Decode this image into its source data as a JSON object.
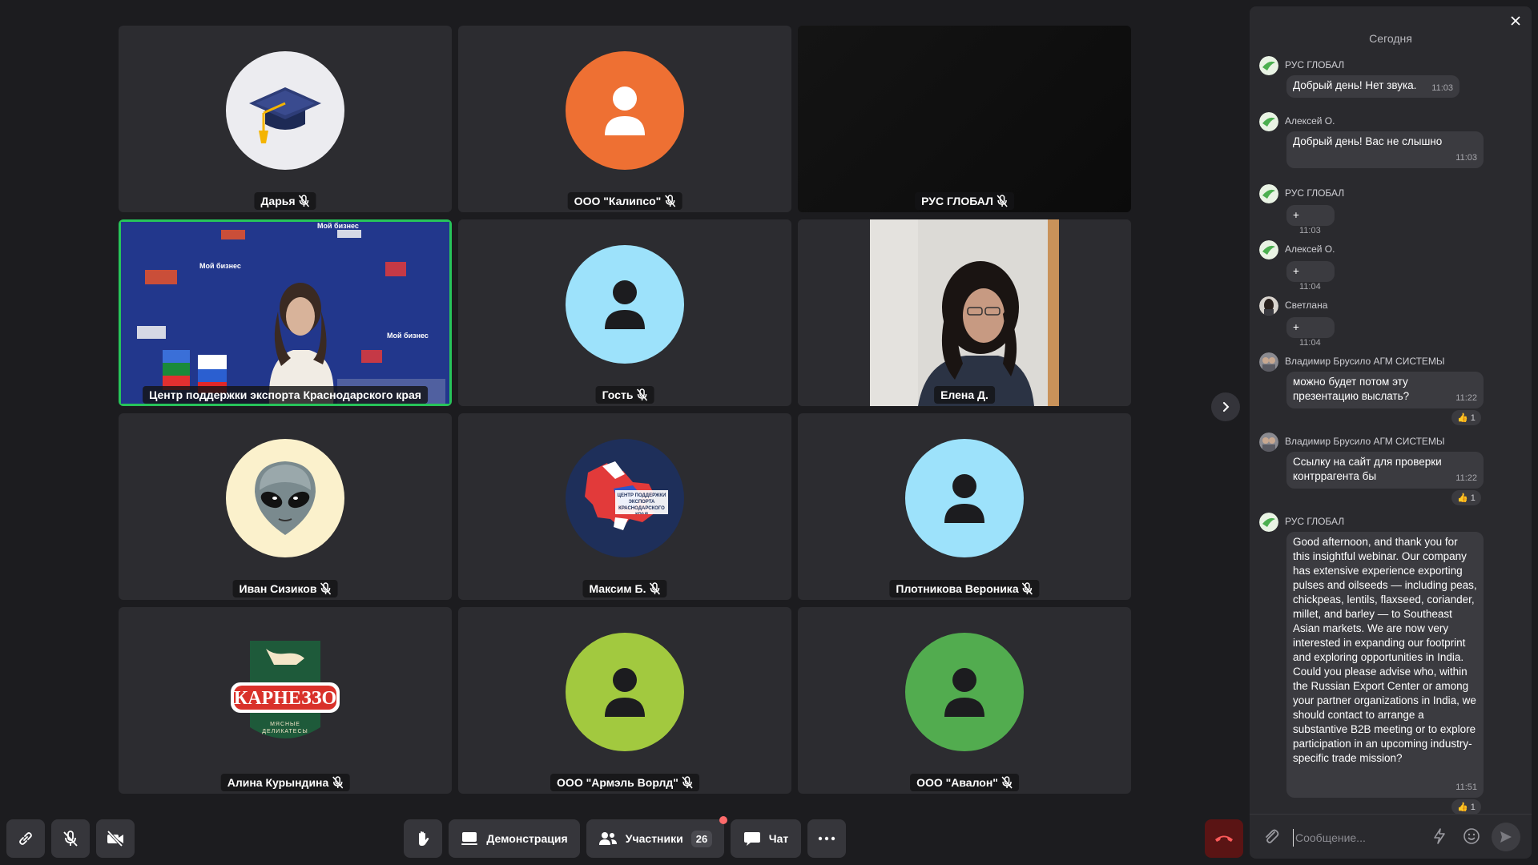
{
  "participants": [
    {
      "name": "Дарья",
      "avatar": "graduation-cap-avatar"
    },
    {
      "name": "ООО \"Калипсо\"",
      "avatar": "person-avatar",
      "color": "#ee7033"
    },
    {
      "name": "РУС ГЛОБАЛ",
      "avatar": "video-dark"
    },
    {
      "name": "Центр поддержки экспорта Краснодарского края",
      "avatar": "video-presenter",
      "speaking": true
    },
    {
      "name": "Гость",
      "avatar": "person-avatar",
      "color": "#9de2fb"
    },
    {
      "name": "Елена Д.",
      "avatar": "video-woman"
    },
    {
      "name": "Иван Сизиков",
      "avatar": "alien-avatar"
    },
    {
      "name": "Максим Б.",
      "avatar": "export-center-logo-avatar"
    },
    {
      "name": "Плотникова Вероника",
      "avatar": "person-avatar",
      "color": "#9de2fb"
    },
    {
      "name": "Алина Курындина",
      "avatar": "karnezzo-logo-avatar"
    },
    {
      "name": "ООО \"Армэль Ворлд\"",
      "avatar": "person-avatar",
      "color": "#a2c93f"
    },
    {
      "name": "ООО \"Авалон\"",
      "avatar": "person-avatar",
      "color": "#52ac4f"
    }
  ],
  "backdrop_logos": [
    "Мой бизнес",
    "Мой бизнес",
    "Мой бизнес"
  ],
  "logo_texts": {
    "export_center": "ЦЕНТР ПОДДЕРЖКИ ЭКСПОРТА КРАСНОДАРСКОГО КРАЯ",
    "karnezzo_brand": "КАРНЕЗЗО",
    "karnezzo_sub": "МЯСНЫЕ ДЕЛИКАТЕСЫ"
  },
  "chat": {
    "date_label": "Сегодня",
    "messages": [
      {
        "author": "РУС ГЛОБАЛ",
        "text": "Добрый день! Нет звука.",
        "time": "11:03"
      },
      {
        "author": "Алексей О.",
        "text": "Добрый день! Вас не слышно",
        "time": "11:03"
      },
      {
        "author": "РУС ГЛОБАЛ",
        "text": "+",
        "time": "11:03"
      },
      {
        "author": "Алексей О.",
        "text": "+",
        "time": "11:04"
      },
      {
        "author": "Светлана",
        "text": "+",
        "time": "11:04"
      },
      {
        "author": "Владимир Брусило АГМ СИСТЕМЫ",
        "text": "можно будет потом эту презентацию выслать?",
        "time": "11:22",
        "reaction": "👍 1"
      },
      {
        "author": "Владимир Брусило АГМ СИСТЕМЫ",
        "text": "Ссылку на сайт для проверки контррагента бы",
        "time": "11:22",
        "reaction": "👍 1"
      },
      {
        "author": "РУС ГЛОБАЛ",
        "text": "Good afternoon, and thank you for this insightful webinar. Our company has extensive experience exporting pulses and oilseeds — including peas, chickpeas, lentils, flaxseed, coriander, millet, and barley — to Southeast Asian markets. We are now very interested in expanding our footprint and exploring opportunities in India. Could you please advise who, within the Russian Export Center or among your partner organizations in India, we should contact to arrange a substantive B2B meeting or to explore participation in an upcoming industry-specific trade mission?",
        "time": "11:51",
        "reaction": "👍 1"
      }
    ],
    "input_placeholder": "Сообщение..."
  },
  "toolbar": {
    "demo_label": "Демонстрация",
    "participants_label": "Участники",
    "participants_count": "26",
    "chat_label": "Чат"
  },
  "colors": {
    "speaking_border": "#27c45a",
    "end_call": "#5a1414",
    "bg": "#1c1c1f"
  }
}
